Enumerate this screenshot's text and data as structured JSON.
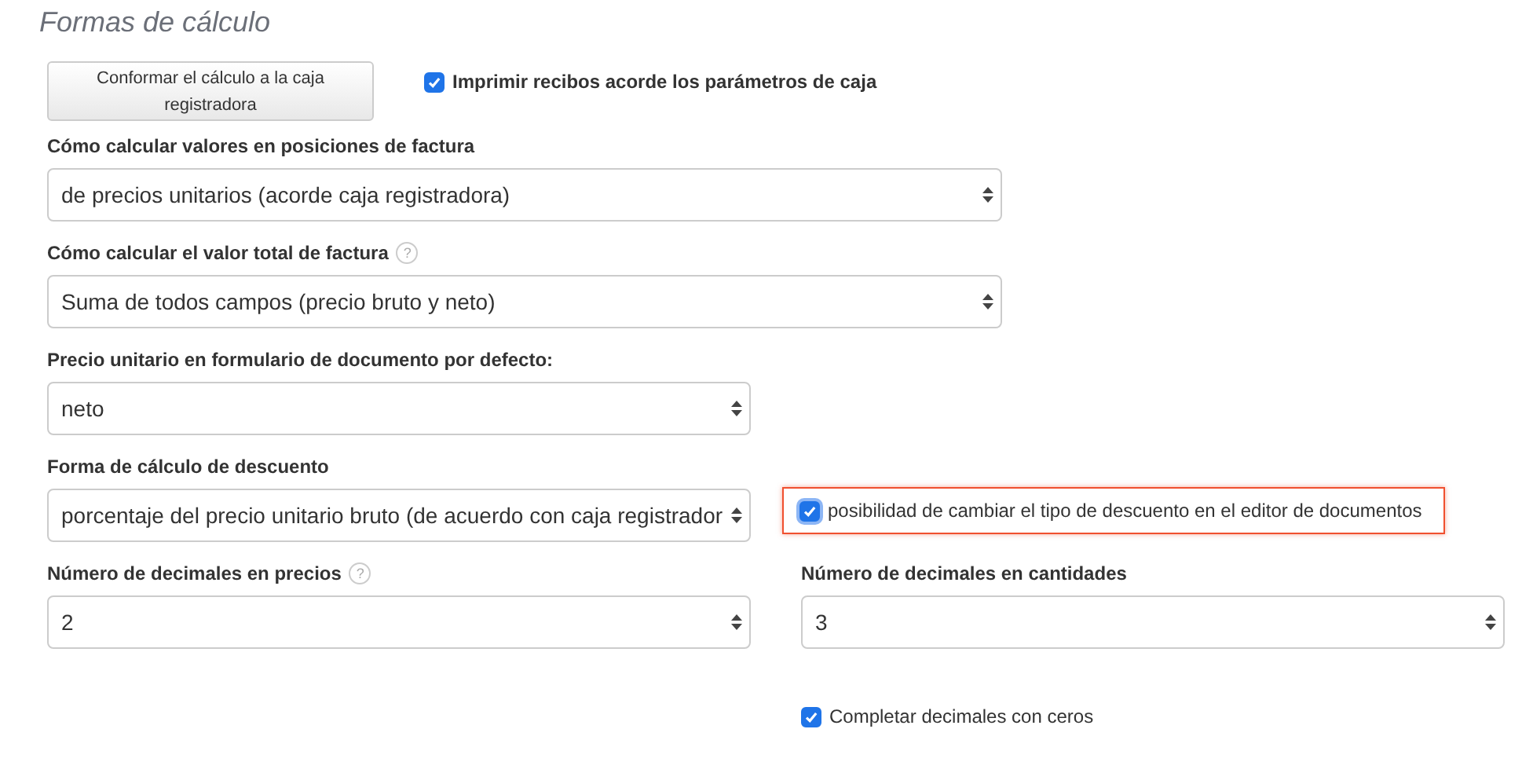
{
  "title": "Formas de cálculo",
  "sync_button": {
    "label": "Conformar el cálculo a la caja registradora"
  },
  "print_receipts": {
    "label": "Imprimir recibos acorde los parámetros de caja",
    "checked": true
  },
  "value_calc": {
    "label": "Cómo calcular valores en posiciones de factura",
    "value": "de precios unitarios (acorde caja registradora)"
  },
  "total_calc": {
    "label": "Cómo calcular el valor total de factura",
    "help": "?",
    "value": "Suma de todos campos (precio bruto y neto)"
  },
  "unit_price": {
    "label": "Precio unitario en formulario de documento por defecto:",
    "value": "neto"
  },
  "discount": {
    "label": "Forma de cálculo de descuento",
    "value": "porcentaje del precio unitario bruto (de acuerdo con caja registrador",
    "option": {
      "label": "posibilidad de cambiar el tipo de descuento en el editor de documentos",
      "checked": true,
      "highlighted": true
    }
  },
  "price_decimals": {
    "label": "Número de decimales en precios",
    "help": "?",
    "value": "2"
  },
  "quantity_decimals": {
    "label": "Número de decimales en cantidades",
    "value": "3"
  },
  "fill_zeros": {
    "label": "Completar decimales con ceros",
    "checked": true
  }
}
